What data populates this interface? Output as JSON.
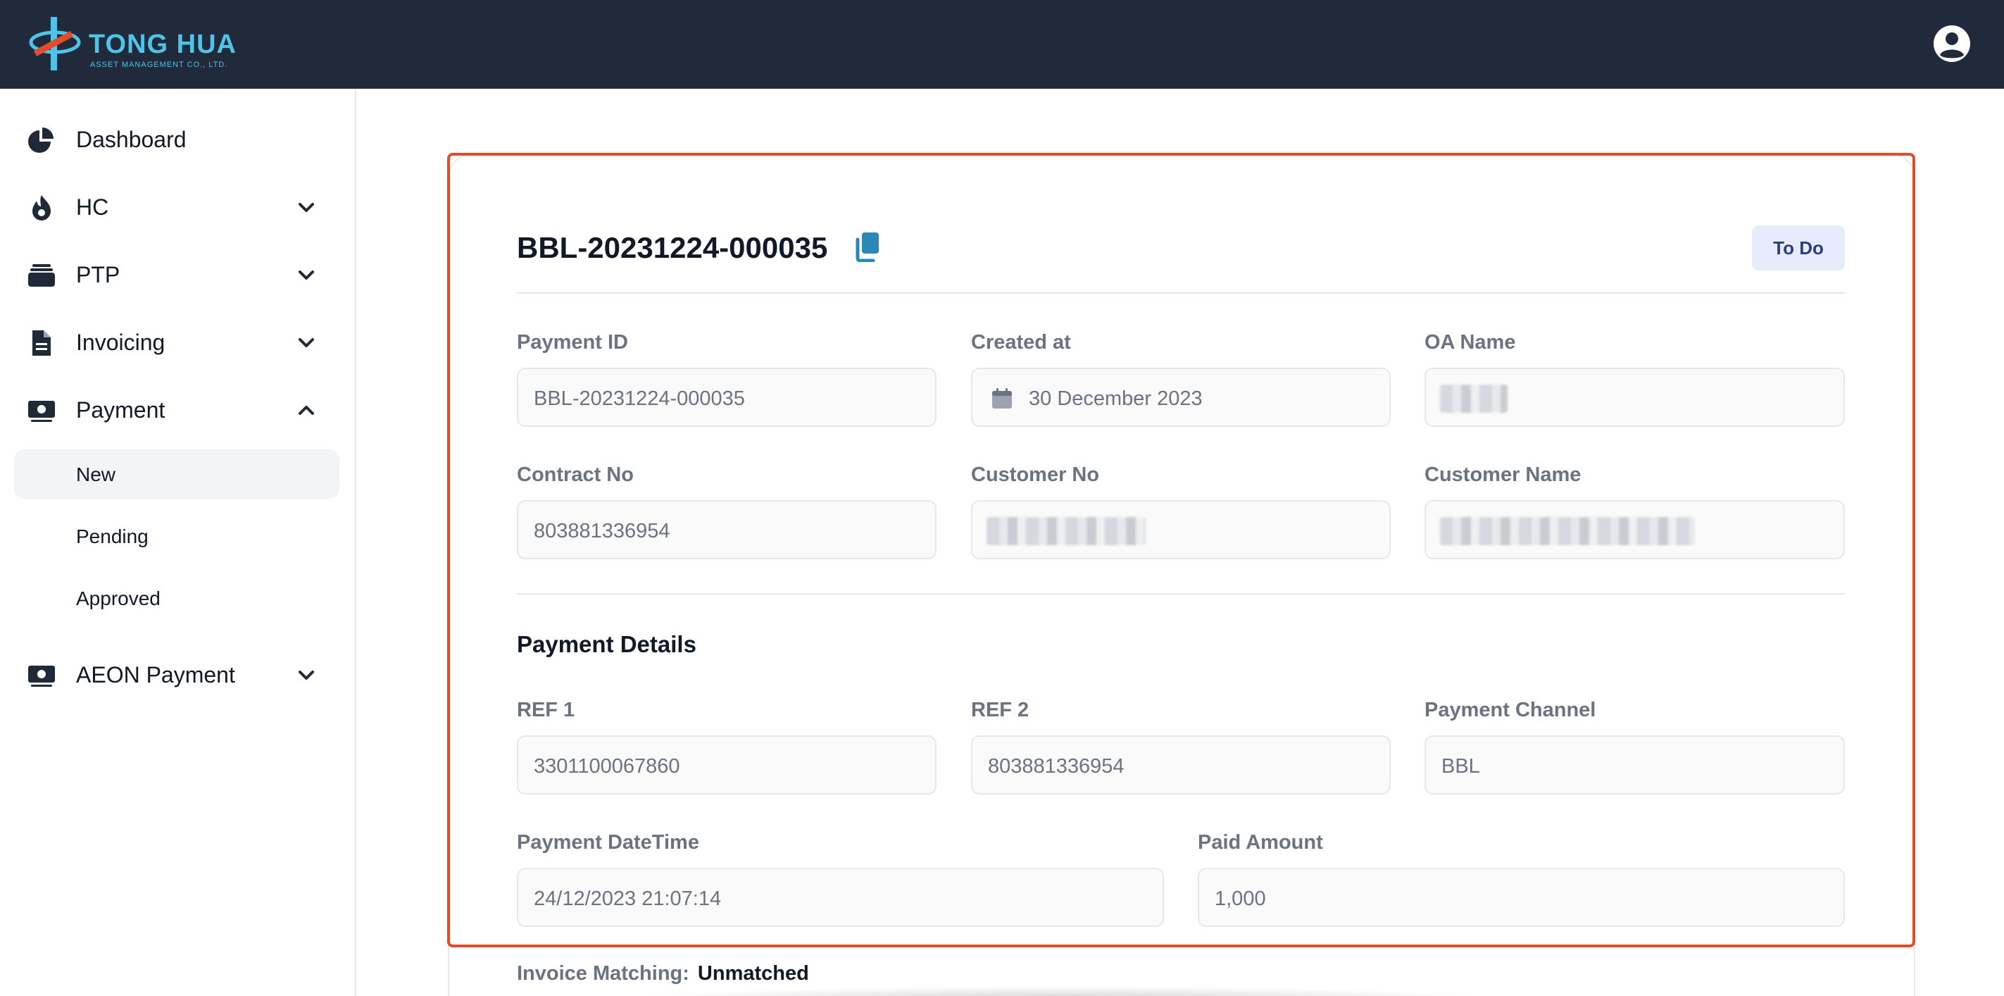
{
  "brand": {
    "name": "TONG HUA",
    "tagline": "ASSET MANAGEMENT CO., LTD.",
    "accent": "#4fc3e8",
    "logo_red": "#e34c2b"
  },
  "header": {
    "user_icon": "user-circle-icon",
    "bg_color": "#212a3a"
  },
  "sidebar": {
    "items": [
      {
        "label": "Dashboard",
        "icon": "pie-chart-icon"
      },
      {
        "label": "HC",
        "icon": "fire-icon",
        "chevron": "down"
      },
      {
        "label": "PTP",
        "icon": "stack-icon",
        "chevron": "down"
      },
      {
        "label": "Invoicing",
        "icon": "document-icon",
        "chevron": "down"
      },
      {
        "label": "Payment",
        "icon": "cash-icon",
        "chevron": "up"
      },
      {
        "label": "AEON Payment",
        "icon": "cash-icon",
        "chevron": "down"
      }
    ],
    "payment_sub": [
      {
        "label": "New",
        "active": true
      },
      {
        "label": "Pending",
        "active": false
      },
      {
        "label": "Approved",
        "active": false
      }
    ]
  },
  "record": {
    "title": "BBL-20231224-000035",
    "status": "To Do"
  },
  "fields": {
    "payment_id": {
      "label": "Payment ID",
      "value": "BBL-20231224-000035"
    },
    "created_at": {
      "label": "Created at",
      "value": "30 December 2023"
    },
    "oa_name": {
      "label": "OA Name",
      "value": ""
    },
    "contract_no": {
      "label": "Contract No",
      "value": "803881336954"
    },
    "customer_no": {
      "label": "Customer No",
      "value": ""
    },
    "customer_name": {
      "label": "Customer Name",
      "value": ""
    }
  },
  "payment_details": {
    "section_title": "Payment Details",
    "ref1": {
      "label": "REF 1",
      "value": "3301100067860"
    },
    "ref2": {
      "label": "REF 2",
      "value": "803881336954"
    },
    "channel": {
      "label": "Payment Channel",
      "value": "BBL"
    },
    "datetime": {
      "label": "Payment DateTime",
      "value": "24/12/2023 21:07:14"
    },
    "amount": {
      "label": "Paid Amount",
      "value": "1,000"
    }
  },
  "invoice_matching": {
    "label": "Invoice Matching:",
    "value": "Unmatched"
  }
}
